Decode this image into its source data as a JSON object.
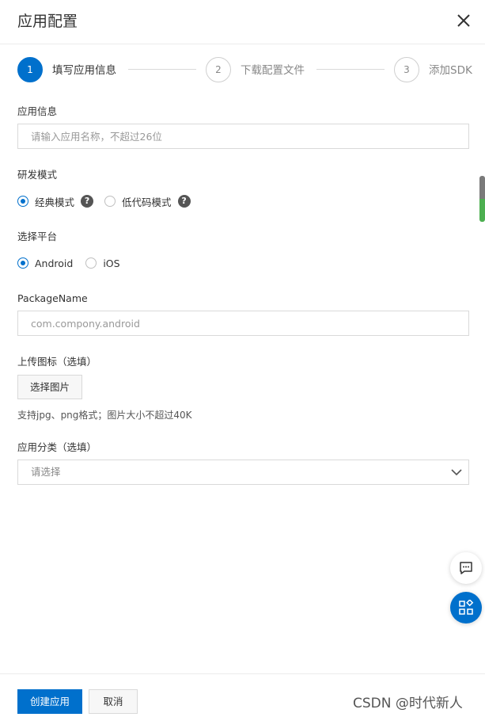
{
  "dialog": {
    "title": "应用配置",
    "close_icon": "close-icon"
  },
  "steps": [
    {
      "number": "1",
      "label": "填写应用信息",
      "state": "active"
    },
    {
      "number": "2",
      "label": "下载配置文件",
      "state": "pending"
    },
    {
      "number": "3",
      "label": "添加SDK",
      "state": "pending"
    }
  ],
  "form": {
    "app_info": {
      "label": "应用信息",
      "value": "",
      "placeholder": "请输入应用名称，不超过26位"
    },
    "dev_mode": {
      "label": "研发模式",
      "options": [
        {
          "label": "经典模式",
          "checked": true,
          "help_icon": "question-icon"
        },
        {
          "label": "低代码模式",
          "checked": false,
          "help_icon": "question-icon"
        }
      ]
    },
    "platform": {
      "label": "选择平台",
      "options": [
        {
          "label": "Android",
          "checked": true
        },
        {
          "label": "iOS",
          "checked": false
        }
      ]
    },
    "package_name": {
      "label": "PackageName",
      "value": "",
      "placeholder": "com.compony.android"
    },
    "icon_upload": {
      "label": "上传图标（选填）",
      "button_label": "选择图片",
      "hint": "支持jpg、png格式；图片大小不超过40K"
    },
    "category": {
      "label": "应用分类（选填）",
      "selected": "请选择",
      "arrow_icon": "chevron-down-icon"
    }
  },
  "floating": {
    "chat_icon": "chat-icon",
    "apps_icon": "apps-icon"
  },
  "footer": {
    "create_label": "创建应用",
    "cancel_label": "取消",
    "watermark": "CSDN @时代新人"
  },
  "colors": {
    "primary": "#0070cc",
    "border": "#d9d9d9",
    "scroll_accent": "#4caf50"
  }
}
